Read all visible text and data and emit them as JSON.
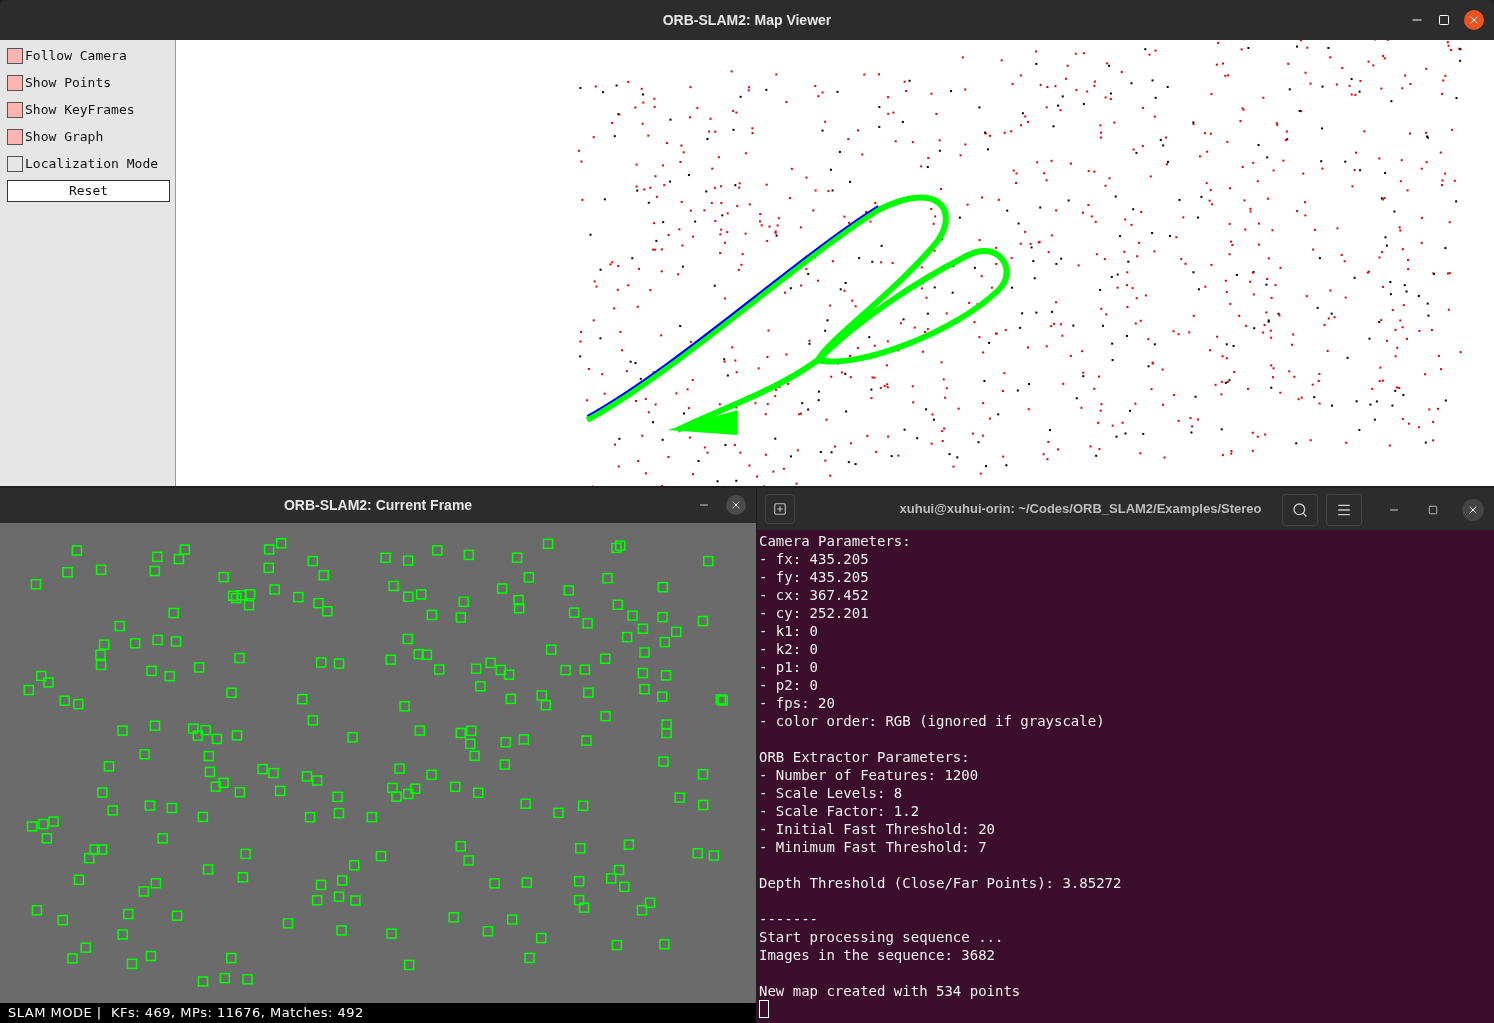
{
  "map_viewer": {
    "title": "ORB-SLAM2: Map Viewer",
    "options": [
      {
        "label": "Follow Camera",
        "checked": true
      },
      {
        "label": "Show Points",
        "checked": true
      },
      {
        "label": "Show KeyFrames",
        "checked": true
      },
      {
        "label": "Show Graph",
        "checked": true
      },
      {
        "label": "Localization Mode",
        "checked": false
      }
    ],
    "reset_button": "Reset"
  },
  "current_frame": {
    "title": "ORB-SLAM2: Current Frame",
    "status_bar": "SLAM MODE |  KFs: 469, MPs: 11676, Matches: 492"
  },
  "terminal": {
    "title": "xuhui@xuhui-orin: ~/Codes/ORB_SLAM2/Examples/Stereo",
    "blocks": [
      [
        "Camera Parameters:",
        "- fx: 435.205",
        "- fy: 435.205",
        "- cx: 367.452",
        "- cy: 252.201",
        "- k1: 0",
        "- k2: 0",
        "- p1: 0",
        "- p2: 0",
        "- fps: 20",
        "- color order: RGB (ignored if grayscale)"
      ],
      [
        "ORB Extractor Parameters:",
        "- Number of Features: 1200",
        "- Scale Levels: 8",
        "- Scale Factor: 1.2",
        "- Initial Fast Threshold: 20",
        "- Minimum Fast Threshold: 7"
      ],
      [
        "Depth Threshold (Close/Far Points): 3.85272"
      ],
      [
        "-------",
        "Start processing sequence ...",
        "Images in the sequence: 3682"
      ],
      [
        "New map created with 534 points"
      ]
    ]
  }
}
